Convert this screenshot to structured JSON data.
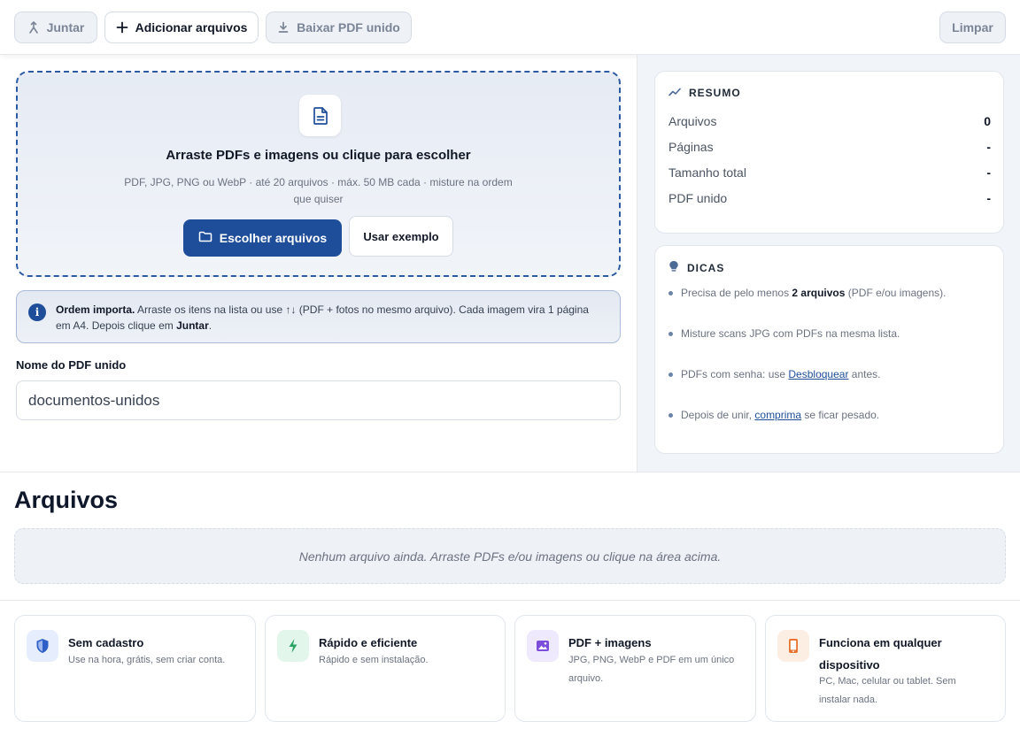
{
  "toolbar": {
    "merge_label": "Juntar",
    "add_files_label": "Adicionar arquivos",
    "download_label": "Baixar PDF unido",
    "clear_label": "Limpar"
  },
  "dropzone": {
    "icon": "file-icon",
    "title": "Arraste PDFs e imagens ou clique para escolher",
    "subtitle": "PDF, JPG, PNG ou WebP · até 20 arquivos · máx. 50 MB cada · misture na ordem que quiser",
    "choose_label": "Escolher arquivos",
    "example_label": "Usar exemplo"
  },
  "info": {
    "icon": "info-icon",
    "lead": "Ordem importa.",
    "text_a": " Arraste os itens na lista ou use ↑↓ (PDF + fotos no mesmo arquivo). Cada imagem vira 1 página em A4. Depois clique em ",
    "emph": "Juntar",
    "text_b": "."
  },
  "name_field": {
    "label": "Nome do PDF unido",
    "value": "documentos-unidos"
  },
  "summary": {
    "title": "RESUMO",
    "rows": [
      {
        "label": "Arquivos",
        "value": "0"
      },
      {
        "label": "Páginas",
        "value": "-"
      },
      {
        "label": "Tamanho total",
        "value": "-"
      },
      {
        "label": "PDF unido",
        "value": "-"
      }
    ]
  },
  "tips": {
    "title": "DICAS",
    "t1_a": "Precisa de pelo menos ",
    "t1_b": "2 arquivos",
    "t1_c": " (PDF e/ou imagens).",
    "t2": "Misture scans JPG com PDFs na mesma lista.",
    "t3_a": "PDFs com senha: use ",
    "t3_link": "Desbloquear",
    "t3_c": " antes.",
    "t4_a": "Depois de unir, ",
    "t4_link": "comprima",
    "t4_c": " se ficar pesado."
  },
  "files": {
    "title": "Arquivos",
    "empty": "Nenhum arquivo ainda. Arraste PDFs e/ou imagens ou clique na área acima."
  },
  "features": [
    {
      "icon": "shield-icon",
      "title": "Sem cadastro",
      "desc": "Use na hora, grátis, sem criar conta."
    },
    {
      "icon": "bolt-icon",
      "title": "Rápido e eficiente",
      "desc": "Rápido e sem instalação."
    },
    {
      "icon": "image-icon",
      "title": "PDF + imagens",
      "desc": "JPG, PNG, WebP e PDF em um único arquivo."
    },
    {
      "icon": "phone-icon",
      "title": "Funciona em qualquer dispositivo",
      "desc": "PC, Mac, celular ou tablet. Sem instalar nada."
    }
  ],
  "colors": {
    "primary": "#1e4e9a",
    "feature_shield_bg": "#e6edfc",
    "feature_bolt_bg": "#e3f6ec",
    "feature_image_bg": "#efe9fd",
    "feature_phone_bg": "#fdeee4"
  }
}
